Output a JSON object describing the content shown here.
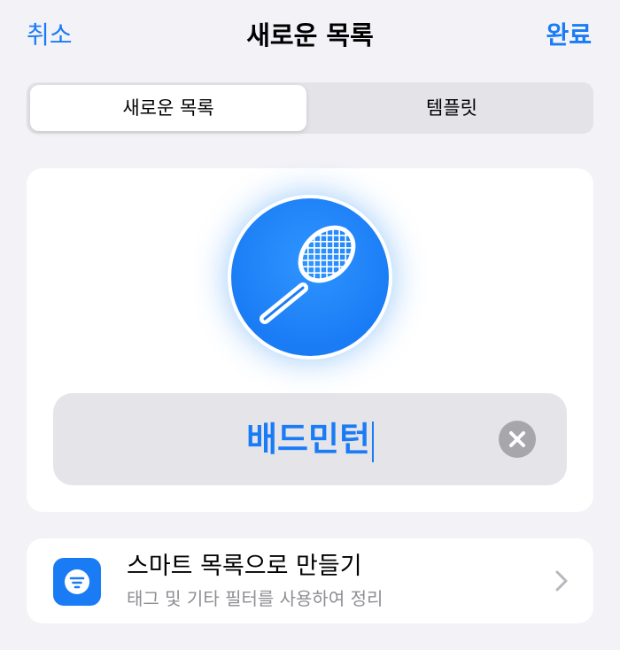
{
  "nav": {
    "cancel_label": "취소",
    "title": "새로운 목록",
    "done_label": "완료"
  },
  "segmented": {
    "selected": "새로운 목록",
    "options": [
      "새로운 목록",
      "템플릿"
    ]
  },
  "list_icon": {
    "icon": "tennis-racket-icon",
    "color": "#1a7cf5"
  },
  "name_field": {
    "value": "배드민턴"
  },
  "smart_list": {
    "icon": "filter-icon",
    "title": "스마트 목록으로 만들기",
    "subtitle": "태그 및 기타 필터를 사용하여 정리"
  },
  "colors": {
    "accent": "#1a7cf5",
    "background": "#f2f2f7",
    "card": "#ffffff",
    "secondary_text": "#8e8e93"
  }
}
